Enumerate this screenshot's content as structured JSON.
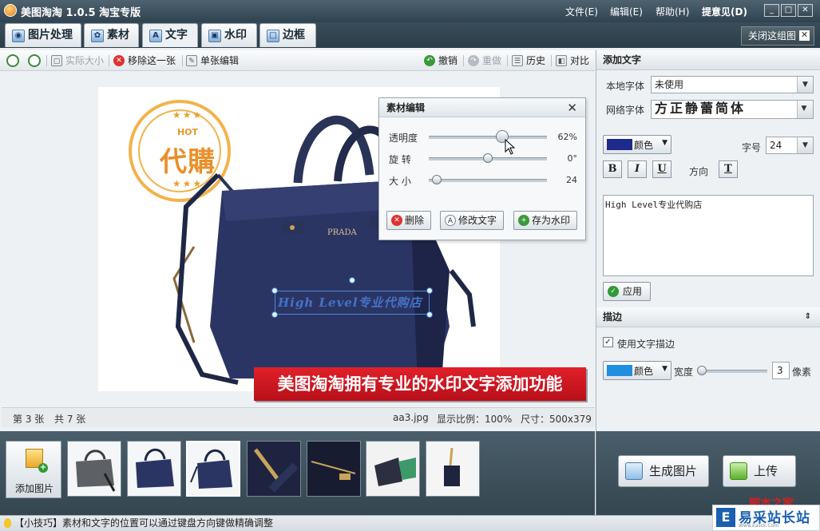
{
  "app": {
    "title": "美图淘淘 1.0.5 淘宝专版",
    "menus": [
      "文件(E)",
      "编辑(E)",
      "帮助(H)",
      "提意见(D)"
    ],
    "window_buttons": [
      "_",
      "□",
      "✕"
    ]
  },
  "tabs": [
    {
      "label": "图片处理",
      "icon": "picture-icon"
    },
    {
      "label": "素材",
      "icon": "material-icon"
    },
    {
      "label": "文字",
      "icon": "text-icon"
    },
    {
      "label": "水印",
      "icon": "watermark-icon"
    },
    {
      "label": "边框",
      "icon": "frame-icon"
    }
  ],
  "close_group": "关闭这组图",
  "toolbar": {
    "actual_size": "实际大小",
    "remove_one": "移除这一张",
    "single_edit": "单张编辑",
    "undo": "撤销",
    "redo": "重做",
    "history": "历史",
    "compare": "对比"
  },
  "canvas": {
    "stamp_top": "HOT",
    "stamp_main": "代購",
    "stamp_stars": "★★★",
    "brand": "PRADA",
    "watermark_text": "High Level专业代购店",
    "banner": "美图淘淘拥有专业的水印文字添加功能"
  },
  "popup": {
    "title": "素材编辑",
    "close": "✕",
    "opacity_label": "透明度",
    "opacity_value": "62%",
    "rotate_label": "旋 转",
    "rotate_value": "0°",
    "size_label": "大 小",
    "size_value": "24",
    "delete": "删除",
    "edit_text": "修改文字",
    "save_watermark": "存为水印",
    "opacity": 0.62
  },
  "status": {
    "current": "第 3 张",
    "total": "共 7 张",
    "filename": "aa3.jpg",
    "ratio": "显示比例：100%",
    "size": "尺寸：500x379"
  },
  "panel": {
    "add_text_title": "添加文字",
    "local_font_label": "本地字体",
    "local_font_value": "未使用",
    "web_font_label": "网络字体",
    "web_font_value": "方正静蕾简体",
    "color_label": "颜色",
    "text_color": "#1e2a8c",
    "font_size_label": "字号",
    "font_size_value": "24",
    "bold": "B",
    "italic": "I",
    "underline": "U",
    "direction_label": "方向",
    "direction_btn": "T",
    "text_content": "High Level专业代购店",
    "apply": "应用",
    "stroke_title": "描边",
    "use_stroke": "使用文字描边",
    "stroke_color": "#1f8fe0",
    "width_label": "宽度",
    "width_value": "3",
    "unit": "像素"
  },
  "filmstrip": {
    "add_image": "添加图片",
    "selected_index": 3
  },
  "actions": {
    "generate": "生成图片",
    "upload": "上传"
  },
  "tip": "【小技巧】素材和文字的位置可以通过键盘方向键做精确调整",
  "watermark_logo": {
    "mark": "E",
    "name": "易采站长站",
    "sub": "Www.Easck.Com",
    "red": "脚本之家"
  }
}
